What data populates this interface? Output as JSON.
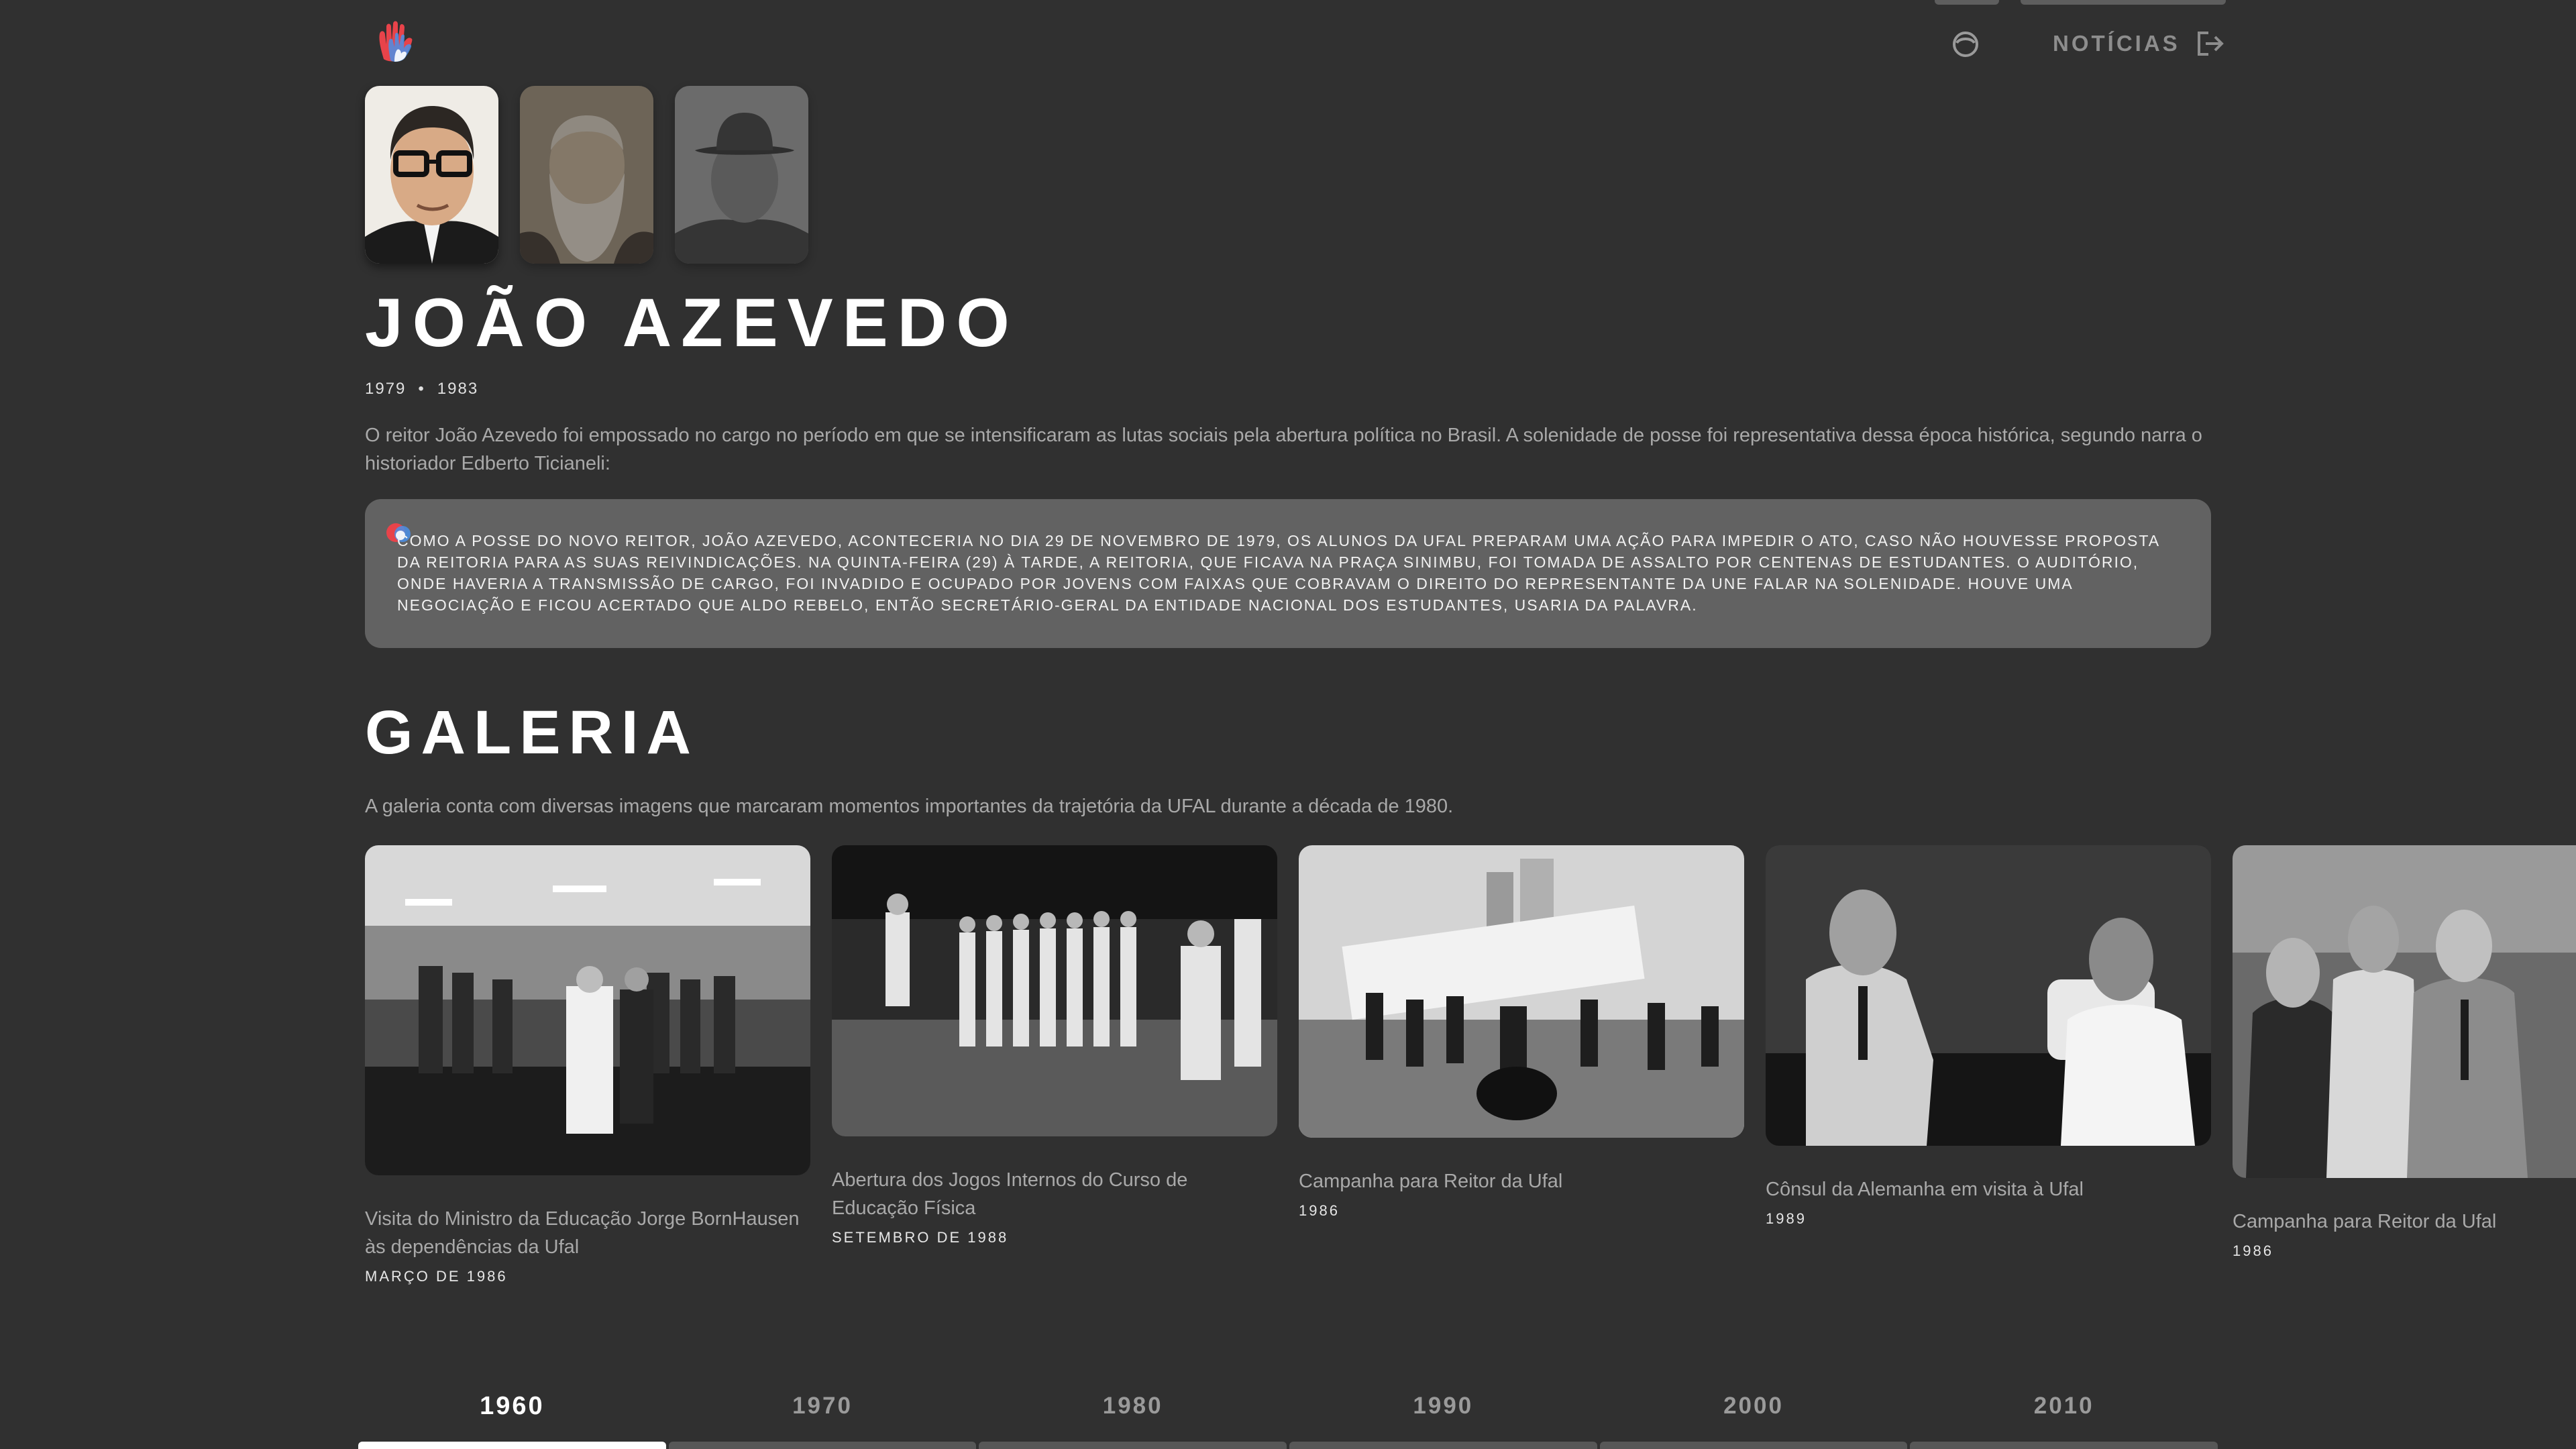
{
  "header": {
    "news_label": "NOTÍCIAS",
    "logo_icon": "hand-logo-icon",
    "accent_colors": [
      "#e8434a",
      "#4a8fe8"
    ]
  },
  "portraits": [
    {
      "name": "portrait-joao-azevedo",
      "selected": true
    },
    {
      "name": "portrait-bearded-man",
      "selected": false
    },
    {
      "name": "portrait-man-with-hat",
      "selected": false
    }
  ],
  "rector": {
    "name": "JOÃO AZEVEDO",
    "start_year": "1979",
    "separator": "•",
    "end_year": "1983",
    "intro": "O reitor João Azevedo foi empossado no cargo no período em que se intensificaram as lutas sociais pela abertura política no Brasil. A solenidade de posse foi representativa dessa época histórica, segundo narra o historiador Edberto Ticianeli:",
    "quote": "Como a posse do novo reitor, João Azevedo, aconteceria no dia 29 de novembro de 1979, os alunos da Ufal preparam uma ação para impedir o ato, caso não houvesse proposta da Reitoria para as suas reivindicações. Na quinta-feira (29) à tarde, a Reitoria, que ficava na Praça Sinimbu, foi tomada de assalto por centenas de estudantes. O auditório, onde haveria a transmissão de cargo, foi invadido e ocupado por jovens com faixas que cobravam o direito do representante da UNE falar na solenidade. Houve uma negociação e ficou acertado que Aldo Rebelo, então secretário-geral da entidade nacional dos estudantes, usaria da palavra."
  },
  "gallery": {
    "title": "GALERIA",
    "description": "A galeria conta com diversas imagens que marcaram momentos importantes da trajetória da UFAL durante a década de 1980.",
    "items": [
      {
        "caption": "Visita do Ministro da Educação Jorge BornHausen às dependências da Ufal",
        "date": "MARÇO DE 1986"
      },
      {
        "caption": "Abertura dos Jogos Internos do Curso de Educação Física",
        "date": "SETEMBRO DE 1988"
      },
      {
        "caption": "Campanha para Reitor da Ufal",
        "date": "1986"
      },
      {
        "caption": "Cônsul da Alemanha em visita à Ufal",
        "date": "1989"
      },
      {
        "caption": "Campanha para Reitor da Ufal",
        "date": "1986"
      }
    ]
  },
  "timeline": {
    "active": "1960",
    "decades": [
      "1960",
      "1970",
      "1980",
      "1990",
      "2000",
      "2010"
    ]
  }
}
